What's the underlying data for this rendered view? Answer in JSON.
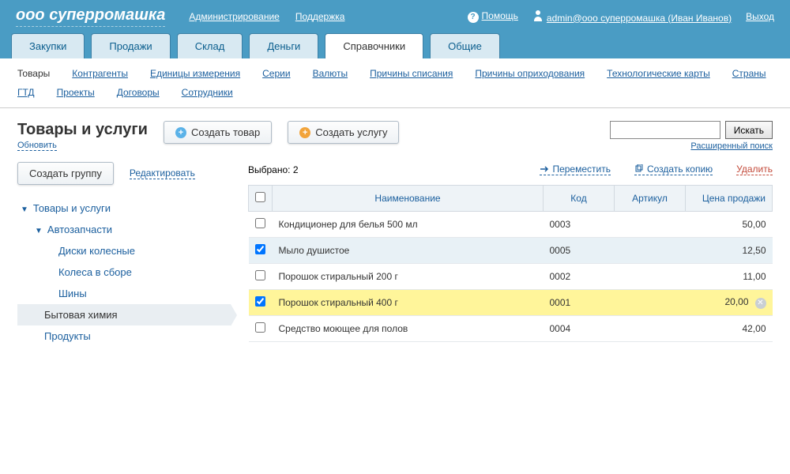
{
  "header": {
    "logo": "ооо суперромашка",
    "admin_link": "Администрирование",
    "support_link": "Поддержка",
    "help": "Помощь",
    "user": "admin@ооо суперромашка (Иван Иванов)",
    "logout": "Выход"
  },
  "tabs": [
    {
      "label": "Закупки",
      "active": false
    },
    {
      "label": "Продажи",
      "active": false
    },
    {
      "label": "Склад",
      "active": false
    },
    {
      "label": "Деньги",
      "active": false
    },
    {
      "label": "Справочники",
      "active": true
    },
    {
      "label": "Общие",
      "active": false
    }
  ],
  "subnav": {
    "current": "Товары",
    "links": [
      "Контрагенты",
      "Единицы измерения",
      "Серии",
      "Валюты",
      "Причины списания",
      "Причины оприходования",
      "Технологические карты",
      "Страны",
      "ГТД",
      "Проекты",
      "Договоры",
      "Сотрудники"
    ]
  },
  "page": {
    "title": "Товары и услуги",
    "refresh": "Обновить",
    "create_product": "Создать товар",
    "create_service": "Создать услугу",
    "search_button": "Искать",
    "advanced_search": "Расширенный поиск",
    "create_group": "Создать группу",
    "edit": "Редактировать",
    "selected_label": "Выбрано: 2",
    "move": "Переместить",
    "copy": "Создать копию",
    "delete": "Удалить"
  },
  "tree": [
    {
      "label": "Товары и услуги",
      "level": 0,
      "caret": true
    },
    {
      "label": "Автозапчасти",
      "level": 1,
      "caret": true
    },
    {
      "label": "Диски колесные",
      "level": 2
    },
    {
      "label": "Колеса в сборе",
      "level": 2
    },
    {
      "label": "Шины",
      "level": 2
    },
    {
      "label": "Бытовая химия",
      "level": 1,
      "active": true
    },
    {
      "label": "Продукты",
      "level": 1
    }
  ],
  "table": {
    "headers": {
      "name": "Наименование",
      "code": "Код",
      "article": "Артикул",
      "price": "Цена продажи"
    },
    "rows": [
      {
        "checked": false,
        "name": "Кондиционер для белья 500 мл",
        "code": "0003",
        "article": "",
        "price": "50,00",
        "sel": false,
        "hl": false
      },
      {
        "checked": true,
        "name": "Мыло душистое",
        "code": "0005",
        "article": "",
        "price": "12,50",
        "sel": true,
        "hl": false
      },
      {
        "checked": false,
        "name": "Порошок стиральный 200 г",
        "code": "0002",
        "article": "",
        "price": "11,00",
        "sel": false,
        "hl": false
      },
      {
        "checked": true,
        "name": "Порошок стиральный 400 г",
        "code": "0001",
        "article": "",
        "price": "20,00",
        "sel": false,
        "hl": true
      },
      {
        "checked": false,
        "name": "Средство моющее для полов",
        "code": "0004",
        "article": "",
        "price": "42,00",
        "sel": false,
        "hl": false
      }
    ]
  }
}
